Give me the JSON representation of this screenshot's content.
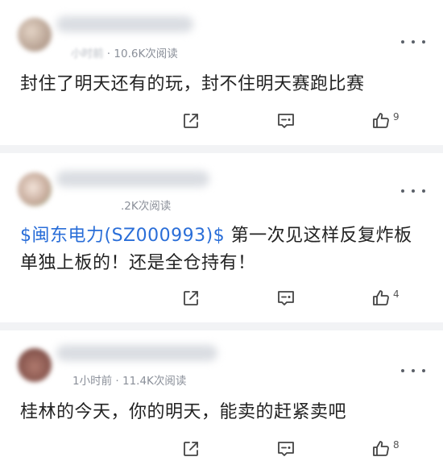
{
  "posts": [
    {
      "author_time_blurred": "小时前",
      "separator": "·",
      "reads": "10.6K次阅读",
      "content_parts": [
        {
          "text": "封住了明天还有的玩，封不住明天赛跑比赛",
          "type": "text"
        }
      ],
      "likes": "9",
      "avatar_color": "#c9b8a8"
    },
    {
      "author_time_blurred": "",
      "separator": "",
      "reads": ".2K次阅读",
      "content_parts": [
        {
          "text": "$闽东电力(SZ000993)$",
          "type": "stock"
        },
        {
          "text": " 第一次见这样反复炸板单独上板的！还是全仓持有！",
          "type": "text"
        }
      ],
      "likes": "4",
      "avatar_color": "#d9c2b4"
    },
    {
      "author_time_blurred": "",
      "time": "1小时前",
      "separator": "·",
      "reads": "11.4K次阅读",
      "content_parts": [
        {
          "text": "桂林的今天，你的明天，能卖的赶紧卖吧",
          "type": "text"
        }
      ],
      "likes": "8",
      "avatar_color": "#b98e86"
    }
  ],
  "icons": {
    "share": "share-icon",
    "comment": "comment-icon",
    "like": "thumbs-up-icon",
    "more": "more-dots-icon"
  },
  "colors": {
    "stock_link": "#2a6ed8",
    "meta": "#8a8f99",
    "divider": "#f2f3f5"
  }
}
